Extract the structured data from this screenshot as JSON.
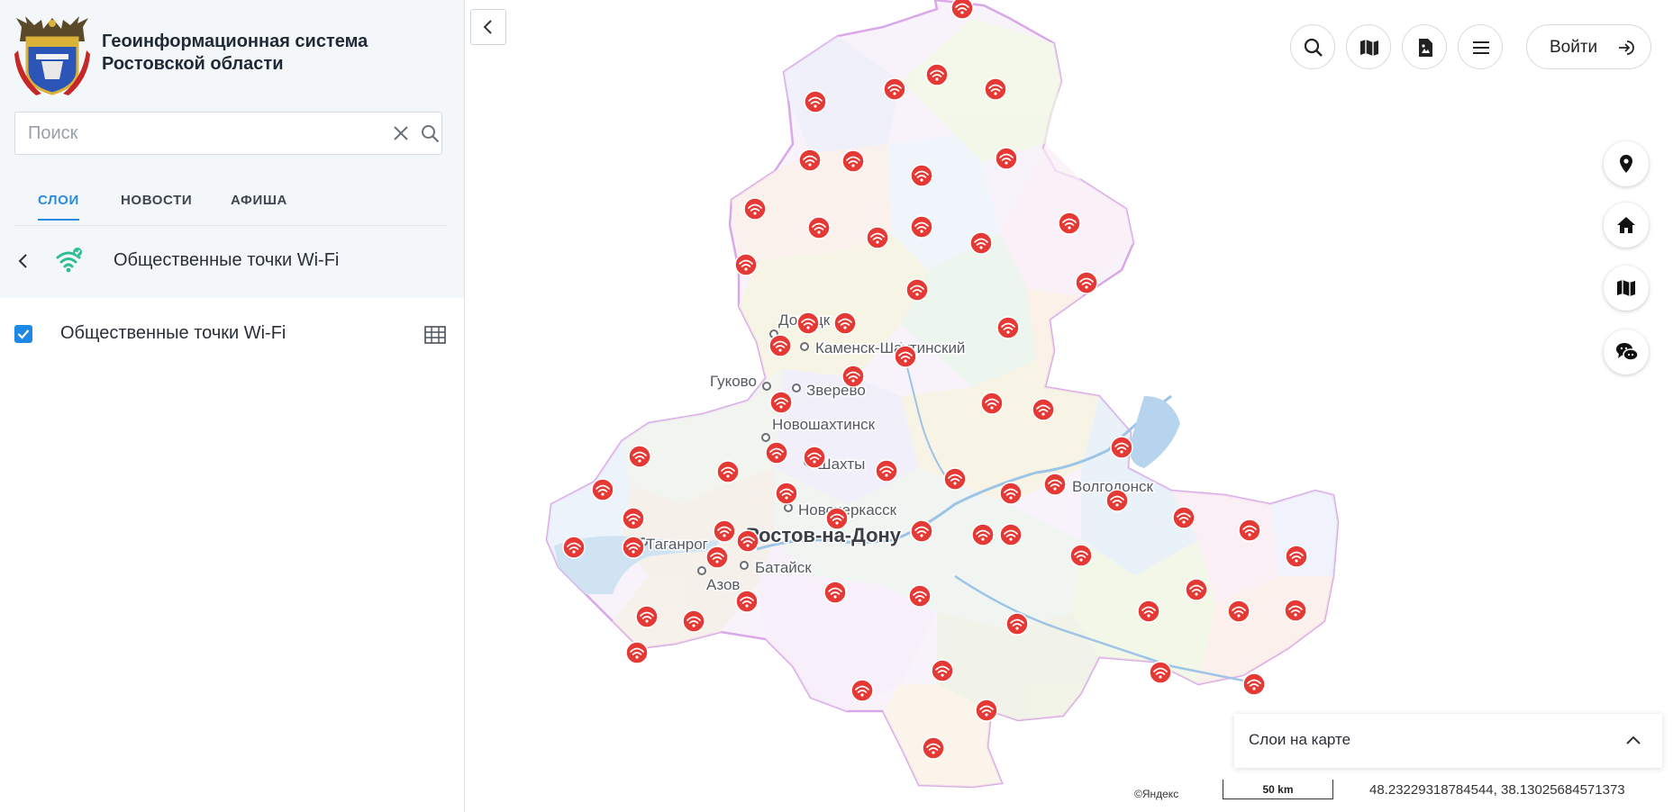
{
  "header": {
    "title_line1": "Геоинформационная система",
    "title_line2": "Ростовской области"
  },
  "search": {
    "placeholder": "Поиск",
    "value": ""
  },
  "tabs": [
    {
      "label": "СЛОИ",
      "active": true
    },
    {
      "label": "НОВОСТИ",
      "active": false
    },
    {
      "label": "АФИША",
      "active": false
    }
  ],
  "layer_group": {
    "title": "Общественные точки Wi-Fi"
  },
  "layers": [
    {
      "name": "Общественные точки Wi-Fi",
      "checked": true
    }
  ],
  "toolbar": {
    "login_label": "Войти",
    "icons": [
      "search-icon",
      "map-icon",
      "image-file-icon",
      "menu-icon"
    ]
  },
  "side_controls": [
    "location-pin-icon",
    "home-icon",
    "map-icon",
    "chat-icon"
  ],
  "map": {
    "cities": [
      {
        "name": "Донецк",
        "dot": true,
        "big": false
      },
      {
        "name": "Каменск-Шахтинский",
        "dot": true,
        "big": false
      },
      {
        "name": "Гуково",
        "dot": true,
        "big": false
      },
      {
        "name": "Зверево",
        "dot": true,
        "big": false
      },
      {
        "name": "Новошахтинск",
        "dot": true,
        "big": false
      },
      {
        "name": "Шахты",
        "dot": true,
        "big": false
      },
      {
        "name": "Новочеркасск",
        "dot": true,
        "big": false
      },
      {
        "name": "Ростов-на-Дону",
        "dot": false,
        "big": true
      },
      {
        "name": "Таганрог",
        "dot": true,
        "big": false
      },
      {
        "name": "Батайск",
        "dot": true,
        "big": false
      },
      {
        "name": "Азов",
        "dot": true,
        "big": false
      },
      {
        "name": "Волгодонск",
        "dot": true,
        "big": false
      }
    ],
    "layers_panel_label": "Слои на карте",
    "copyright": "©Яндекс",
    "scale_label": "50 km",
    "coordinates": "48.23229318784544, 38.13025684571373",
    "marker_color": "#e53935"
  }
}
